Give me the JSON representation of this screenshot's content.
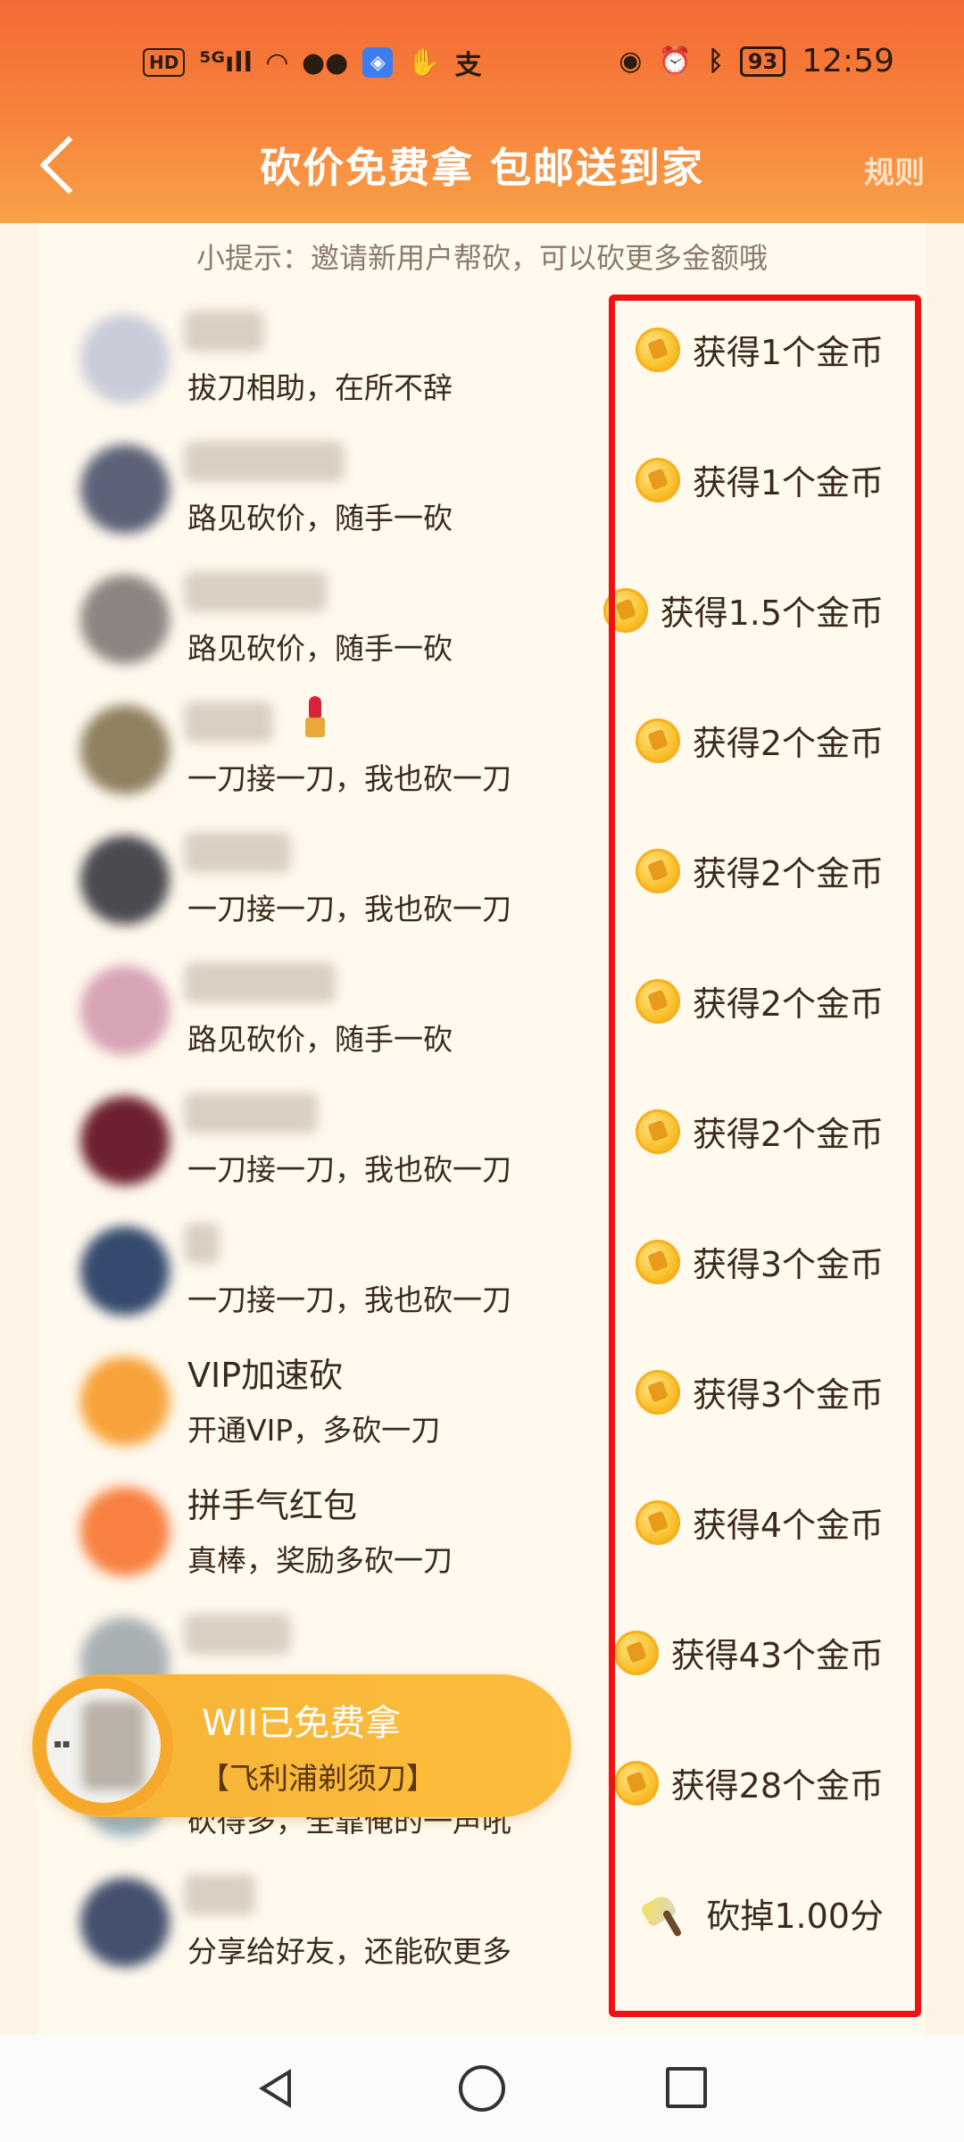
{
  "status_bar": {
    "left_icons": [
      "HD",
      "5G signal",
      "wifi",
      "wechat",
      "app",
      "hand",
      "alipay"
    ],
    "battery": "93",
    "time": "12:59"
  },
  "header": {
    "title": "砍价免费拿 包邮送到家",
    "rules_label": "规则"
  },
  "tip": "小提示：邀请新用户帮砍，可以砍更多金额哦",
  "rows": [
    {
      "name": "",
      "subtitle": "拔刀相助，在所不辞",
      "reward": "获得1个金币",
      "reward_icon": "coin-icon",
      "avatar_color": "#c9ccd8"
    },
    {
      "name": "",
      "subtitle": "路见砍价，随手一砍",
      "reward": "获得1个金币",
      "reward_icon": "coin-icon",
      "avatar_color": "#5d6278"
    },
    {
      "name": "",
      "subtitle": "路见砍价，随手一砍",
      "reward": "获得1.5个金币",
      "reward_icon": "coin-icon",
      "avatar_color": "#8c8480"
    },
    {
      "name": "",
      "subtitle": "一刀接一刀，我也砍一刀",
      "reward": "获得2个金币",
      "reward_icon": "coin-icon",
      "avatar_color": "#8f8060"
    },
    {
      "name": "",
      "subtitle": "一刀接一刀，我也砍一刀",
      "reward": "获得2个金币",
      "reward_icon": "coin-icon",
      "avatar_color": "#4a4a50"
    },
    {
      "name": "",
      "subtitle": "路见砍价，随手一砍",
      "reward": "获得2个金币",
      "reward_icon": "coin-icon",
      "avatar_color": "#d7a3b6"
    },
    {
      "name": "",
      "subtitle": "一刀接一刀，我也砍一刀",
      "reward": "获得2个金币",
      "reward_icon": "coin-icon",
      "avatar_color": "#6e2030"
    },
    {
      "name": "",
      "subtitle": "一刀接一刀，我也砍一刀",
      "reward": "获得3个金币",
      "reward_icon": "coin-icon",
      "avatar_color": "#354a6e"
    },
    {
      "name": "VIP加速砍",
      "subtitle": "开通VIP，多砍一刀",
      "reward": "获得3个金币",
      "reward_icon": "coin-icon",
      "avatar_color": "#f7a23a"
    },
    {
      "name": "拼手气红包",
      "subtitle": "真棒，奖励多砍一刀",
      "reward": "获得4个金币",
      "reward_icon": "coin-icon",
      "avatar_color": "#f88040"
    },
    {
      "name": "",
      "subtitle": "",
      "reward": "获得43个金币",
      "reward_icon": "coin-icon",
      "avatar_color": "#a9b0b4"
    },
    {
      "name": "",
      "subtitle": "砍得多，全靠俺的一声吼",
      "reward": "获得28个金币",
      "reward_icon": "coin-icon",
      "avatar_color": "#9cb4c2"
    },
    {
      "name": "",
      "subtitle": "分享给好友，还能砍更多",
      "reward": "砍掉1.00分",
      "reward_icon": "knife-icon",
      "avatar_color": "#44506e"
    }
  ],
  "toast": {
    "title": "WII已免费拿",
    "product": "【飞利浦剃须刀】"
  },
  "colors": {
    "header_top": "#f46a35",
    "header_bottom": "#f9a248",
    "highlight": "#ee1212",
    "toast": "#f9b93a"
  }
}
